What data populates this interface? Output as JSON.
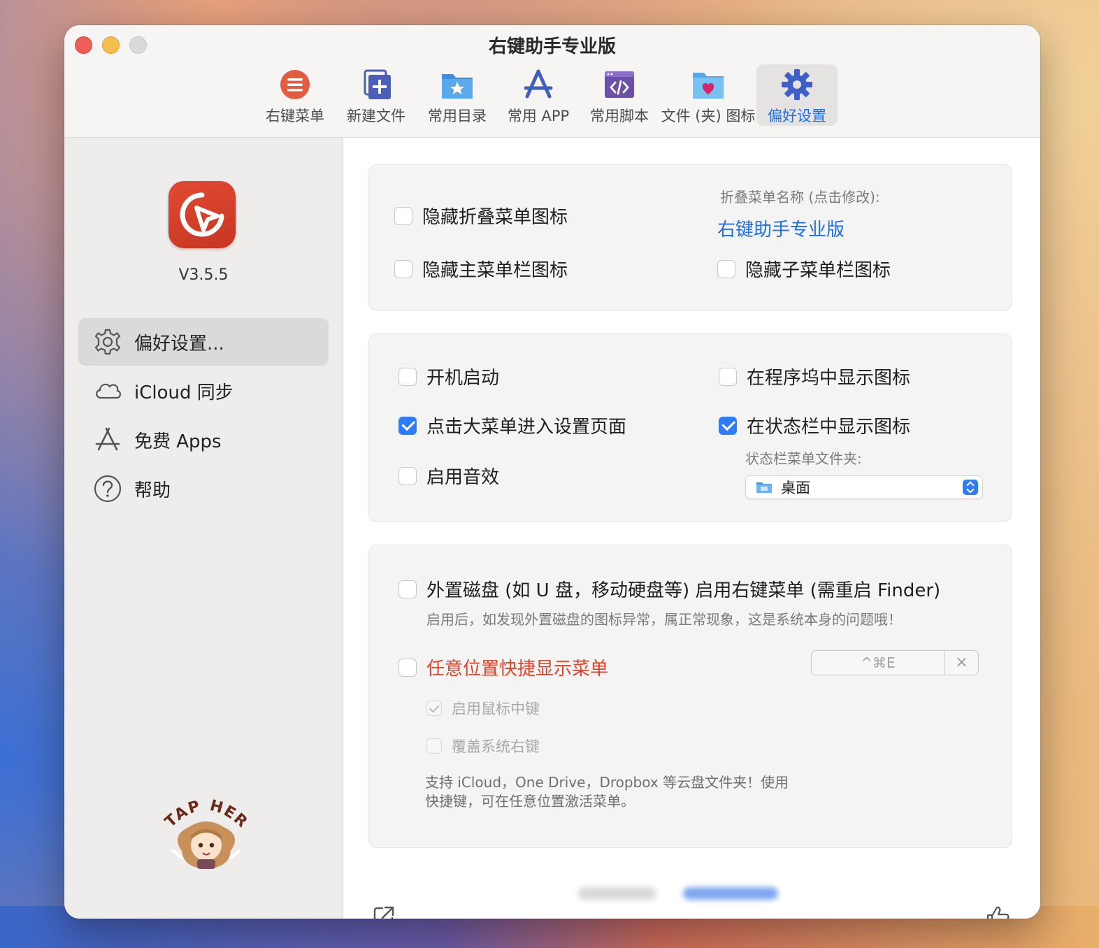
{
  "window": {
    "title": "右键助手专业版"
  },
  "toolbar": {
    "items": [
      {
        "label": "右键菜单",
        "icon": "list-icon"
      },
      {
        "label": "新建文件",
        "icon": "new-file-icon"
      },
      {
        "label": "常用目录",
        "icon": "star-folder-icon"
      },
      {
        "label": "常用 APP",
        "icon": "app-store-icon"
      },
      {
        "label": "常用脚本",
        "icon": "script-icon"
      },
      {
        "label": "文件 (夹) 图标",
        "icon": "heart-folder-icon"
      },
      {
        "label": "偏好设置",
        "icon": "gear-icon",
        "active": true
      }
    ]
  },
  "sidebar": {
    "version": "V3.5.5",
    "items": [
      {
        "label": "偏好设置...",
        "icon": "gear-icon",
        "active": true
      },
      {
        "label": "iCloud 同步",
        "icon": "cloud-icon"
      },
      {
        "label": "免费 Apps",
        "icon": "app-store-icon"
      },
      {
        "label": "帮助",
        "icon": "help-icon"
      }
    ],
    "mascot_text": "TAP HERE"
  },
  "panel1": {
    "hide_fold_icon": {
      "label": "隐藏折叠菜单图标",
      "checked": false
    },
    "hide_main_icon": {
      "label": "隐藏主菜单栏图标",
      "checked": false
    },
    "fold_name_caption": "折叠菜单名称 (点击修改):",
    "fold_name_value": "右键助手专业版",
    "hide_sub_icon": {
      "label": "隐藏子菜单栏图标",
      "checked": false
    }
  },
  "panel2": {
    "launch_at_login": {
      "label": "开机启动",
      "checked": false
    },
    "click_to_settings": {
      "label": "点击大菜单进入设置页面",
      "checked": true
    },
    "enable_sound": {
      "label": "启用音效",
      "checked": false
    },
    "show_in_dock": {
      "label": "在程序坞中显示图标",
      "checked": false
    },
    "show_in_statusbar": {
      "label": "在状态栏中显示图标",
      "checked": true
    },
    "statusbar_folder_caption": "状态栏菜单文件夹:",
    "statusbar_folder_value": "桌面"
  },
  "panel3": {
    "external_disk": {
      "label": "外置磁盘 (如 U 盘，移动硬盘等) 启用右键菜单 (需重启 Finder)",
      "checked": false
    },
    "external_disk_note": "启用后，如发现外置磁盘的图标异常，属正常现象，这是系统本身的问题哦！",
    "anywhere_menu": {
      "label": "任意位置快捷显示菜单",
      "checked": false
    },
    "shortcut_keys": "^⌘E",
    "shortcut_clear": "×",
    "middle_click": {
      "label": "启用鼠标中键",
      "checked": true
    },
    "override_right": {
      "label": "覆盖系统右键",
      "checked": false
    },
    "help_line1": "支持 iCloud，One Drive，Dropbox 等云盘文件夹！使用",
    "help_line2": "快捷键，可在任意位置激活菜单。"
  },
  "colors": {
    "accent": "#2f7cf6",
    "link": "#1f6ee6",
    "warning": "#e0442a",
    "logo": "#d23c27"
  }
}
